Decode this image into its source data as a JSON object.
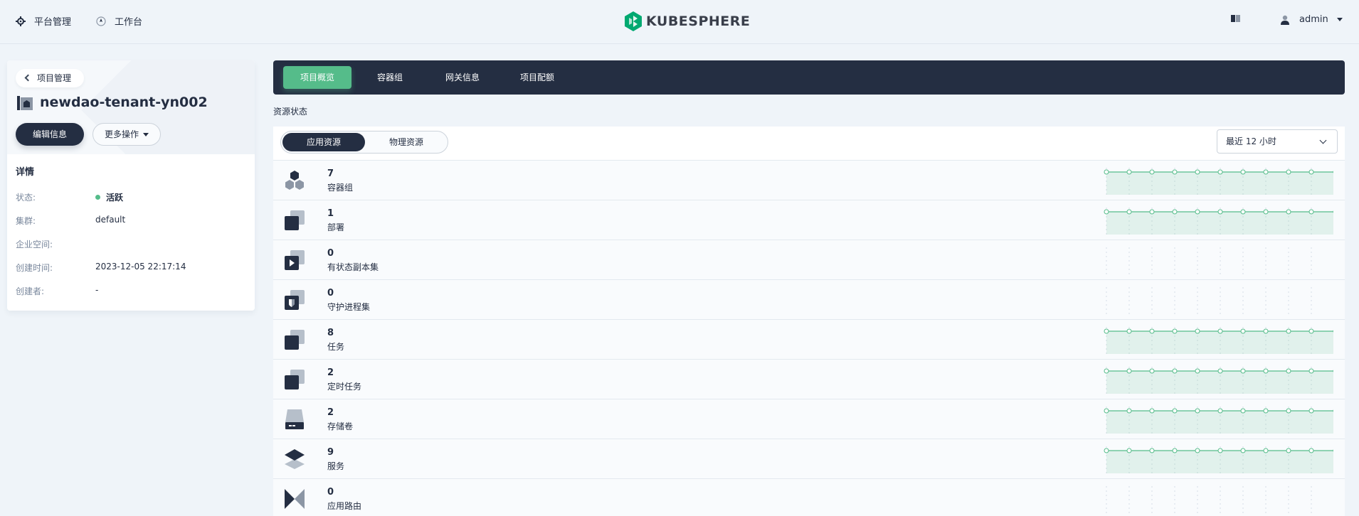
{
  "header": {
    "platform_label": "平台管理",
    "workbench_label": "工作台",
    "logo_text": "KUBESPHERE",
    "user_name": "admin"
  },
  "project": {
    "back_label": "项目管理",
    "name": "newdao-tenant-yn002",
    "edit_label": "编辑信息",
    "more_label": "更多操作",
    "details_title": "详情",
    "details": [
      {
        "key": "状态:",
        "value": "活跃",
        "status": true
      },
      {
        "key": "集群:",
        "value": "default"
      },
      {
        "key": "企业空间:",
        "value": ""
      },
      {
        "key": "创建时间:",
        "value": "2023-12-05 22:17:14"
      },
      {
        "key": "创建者:",
        "value": "-"
      }
    ]
  },
  "tabs": [
    "项目概览",
    "容器组",
    "网关信息",
    "项目配额"
  ],
  "section_title": "资源状态",
  "toggle": {
    "active": "应用资源",
    "other": "物理资源"
  },
  "time_range": "最近 12 小时",
  "resources": [
    {
      "count": "7",
      "label": "容器组",
      "icon": "pods-icon",
      "chart": true
    },
    {
      "count": "1",
      "label": "部署",
      "icon": "deployment-icon",
      "chart": true
    },
    {
      "count": "0",
      "label": "有状态副本集",
      "icon": "statefulset-icon",
      "chart": false
    },
    {
      "count": "0",
      "label": "守护进程集",
      "icon": "daemonset-icon",
      "chart": false
    },
    {
      "count": "8",
      "label": "任务",
      "icon": "job-icon",
      "chart": true
    },
    {
      "count": "2",
      "label": "定时任务",
      "icon": "cronjob-icon",
      "chart": true
    },
    {
      "count": "2",
      "label": "存储卷",
      "icon": "volume-icon",
      "chart": true
    },
    {
      "count": "9",
      "label": "服务",
      "icon": "service-icon",
      "chart": true
    },
    {
      "count": "0",
      "label": "应用路由",
      "icon": "route-icon",
      "chart": false
    }
  ],
  "colors": {
    "accent": "#55bc8a",
    "dark": "#242e42",
    "bg": "#eff4f9"
  }
}
